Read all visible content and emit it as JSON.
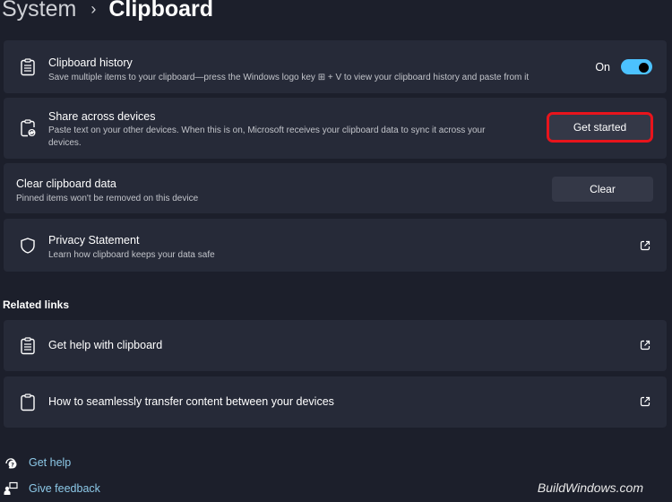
{
  "header": {
    "breadcrumb_parent": "System",
    "breadcrumb_separator": "›",
    "page_title": "Clipboard"
  },
  "settings": [
    {
      "title": "Clipboard history",
      "description": "Save multiple items to your clipboard—press the Windows logo key ⊞ + V to view your clipboard history and paste from it",
      "toggle_label": "On",
      "toggle_on": true,
      "icon": "clipboard-list-icon"
    },
    {
      "title": "Share across devices",
      "description_line1": "Paste text on your other devices. When this is on, Microsoft receives your clipboard data to sync it across your",
      "description_line2": "devices.",
      "button_label": "Get started",
      "icon": "clipboard-sync-icon"
    },
    {
      "title": "Clear clipboard data",
      "description": "Pinned items won't be removed on this device",
      "button_label": "Clear"
    },
    {
      "title": "Privacy Statement",
      "description": "Learn how clipboard keeps your data safe",
      "icon": "shield-icon",
      "action_icon": "external-link-icon"
    }
  ],
  "related": {
    "label": "Related links",
    "items": [
      {
        "title": "Get help with clipboard",
        "icon": "clipboard-list-icon",
        "action_icon": "external-link-icon"
      },
      {
        "title": "How to seamlessly transfer content between your devices",
        "icon": "clipboard-icon",
        "action_icon": "external-link-icon"
      }
    ]
  },
  "footer": {
    "get_help": "Get help",
    "give_feedback": "Give feedback"
  },
  "watermark": "BuildWindows.com",
  "colors": {
    "background": "#1c1f2b",
    "card": "#262a38",
    "accent": "#4cc2ff",
    "link": "#8dc9e8",
    "highlight": "#e8141c"
  }
}
